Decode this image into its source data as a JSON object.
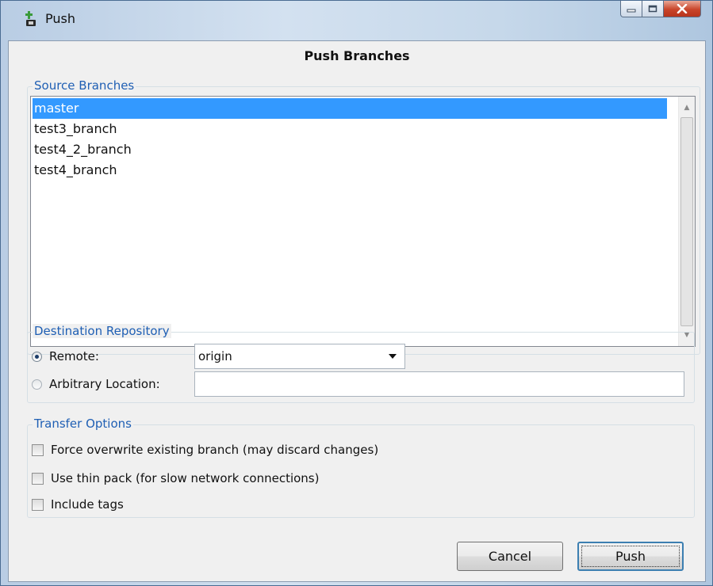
{
  "window": {
    "title": "Push",
    "controls": [
      "minimize-icon",
      "maximize-icon",
      "close-icon"
    ]
  },
  "dialog": {
    "heading": "Push Branches"
  },
  "source_branches": {
    "label": "Source Branches",
    "items": [
      "master",
      "test3_branch",
      "test4_2_branch",
      "test4_branch"
    ],
    "selected": "master"
  },
  "destination": {
    "label": "Destination Repository",
    "remote_label": "Remote:",
    "remote_value": "origin",
    "remote_selected": true,
    "arbitrary_label": "Arbitrary Location:",
    "arbitrary_value": ""
  },
  "transfer_options": {
    "label": "Transfer Options",
    "options": [
      {
        "label": "Force overwrite existing branch (may discard changes)",
        "checked": false
      },
      {
        "label": "Use thin pack (for slow network connections)",
        "checked": false
      },
      {
        "label": "Include tags",
        "checked": false
      }
    ]
  },
  "buttons": {
    "cancel": "Cancel",
    "push": "Push"
  },
  "colors": {
    "group_label": "#1f5fb4",
    "selection": "#3399ff"
  }
}
